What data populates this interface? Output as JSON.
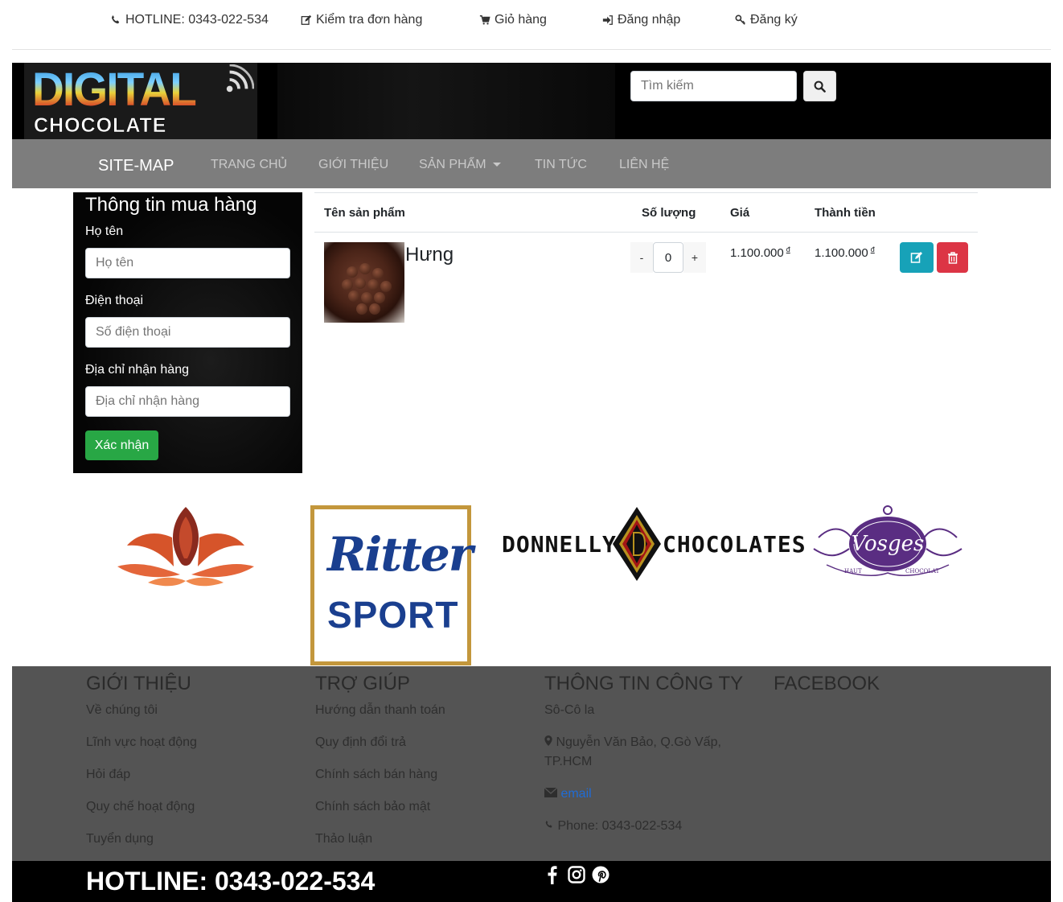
{
  "topbar": {
    "hotline": "HOTLINE: 0343-022-534",
    "check_order": "Kiểm tra đơn hàng",
    "cart": "Giỏ hàng",
    "login": "Đăng nhập",
    "register": "Đăng ký"
  },
  "header": {
    "logo_line1": "DIGITAL",
    "logo_line2": "CHOCOLATE",
    "search_placeholder": "Tìm kiếm"
  },
  "nav": {
    "brand": "SITE-MAP",
    "links": [
      "TRANG CHỦ",
      "GIỚI THIỆU",
      "SẢN PHẨM",
      "TIN TỨC",
      "LIÊN HỆ"
    ]
  },
  "order_form": {
    "title": "Thông tin mua hàng",
    "name_label": "Họ tên",
    "name_placeholder": "Họ tên",
    "phone_label": "Điện thoại",
    "phone_placeholder": "Số điện thoại",
    "address_label": "Địa chỉ nhận hàng",
    "address_placeholder": "Địa chỉ nhận hàng",
    "submit": "Xác nhận"
  },
  "cart": {
    "headers": [
      "Tên sản phẩm",
      "Số lượng",
      "Giá",
      "Thành tiền"
    ],
    "items": [
      {
        "name": "Hưng",
        "quantity": "0",
        "minus": "-",
        "plus": "+",
        "price": "1.100.000",
        "total": "1.100.000",
        "currency": "đ"
      }
    ]
  },
  "brands": {
    "ritter_line1": "Ritter",
    "ritter_line2": "SPORT",
    "donnelly_left": "DONNELLY",
    "donnelly_right": "CHOCOLATES",
    "vosges": "Vosges",
    "vosges_sub_left": "HAUT",
    "vosges_sub_right": "CHOCOLAT"
  },
  "footer": {
    "about": {
      "title": "GIỚI THIỆU",
      "links": [
        "Về chúng tôi",
        "Lĩnh vực hoạt động",
        "Hỏi đáp",
        "Quy chế hoạt động",
        "Tuyển dụng"
      ]
    },
    "help": {
      "title": "TRỢ GIÚP",
      "links": [
        "Hướng dẫn thanh toán",
        "Quy định đổi trả",
        "Chính sách bán hàng",
        "Chính sách bảo mật",
        "Thảo luận"
      ]
    },
    "company": {
      "title": "THÔNG TIN CÔNG TY",
      "name": "Sô-Cô la",
      "address_line1": "Nguyễn Văn Bảo, Q.Gò Vấp,",
      "address_line2": "TP.HCM",
      "email": "email",
      "phone": "Phone: 0343-022-534"
    },
    "facebook": {
      "title": "FACEBOOK"
    },
    "hotline": "HOTLINE: 0343-022-534"
  },
  "colors": {
    "nav_bg": "#7d7d7d",
    "footer_bg": "#545454",
    "success": "#28a745",
    "info": "#17a2b8",
    "danger": "#dc3545",
    "ritter_blue": "#1a3f8f",
    "vosges_purple": "#5a2d82"
  },
  "icons": [
    "phone-icon",
    "edit-icon",
    "cart-icon",
    "sign-in-icon",
    "key-icon",
    "search-icon",
    "trash-icon",
    "map-marker-icon",
    "envelope-icon",
    "facebook-icon",
    "instagram-icon",
    "pinterest-icon"
  ]
}
